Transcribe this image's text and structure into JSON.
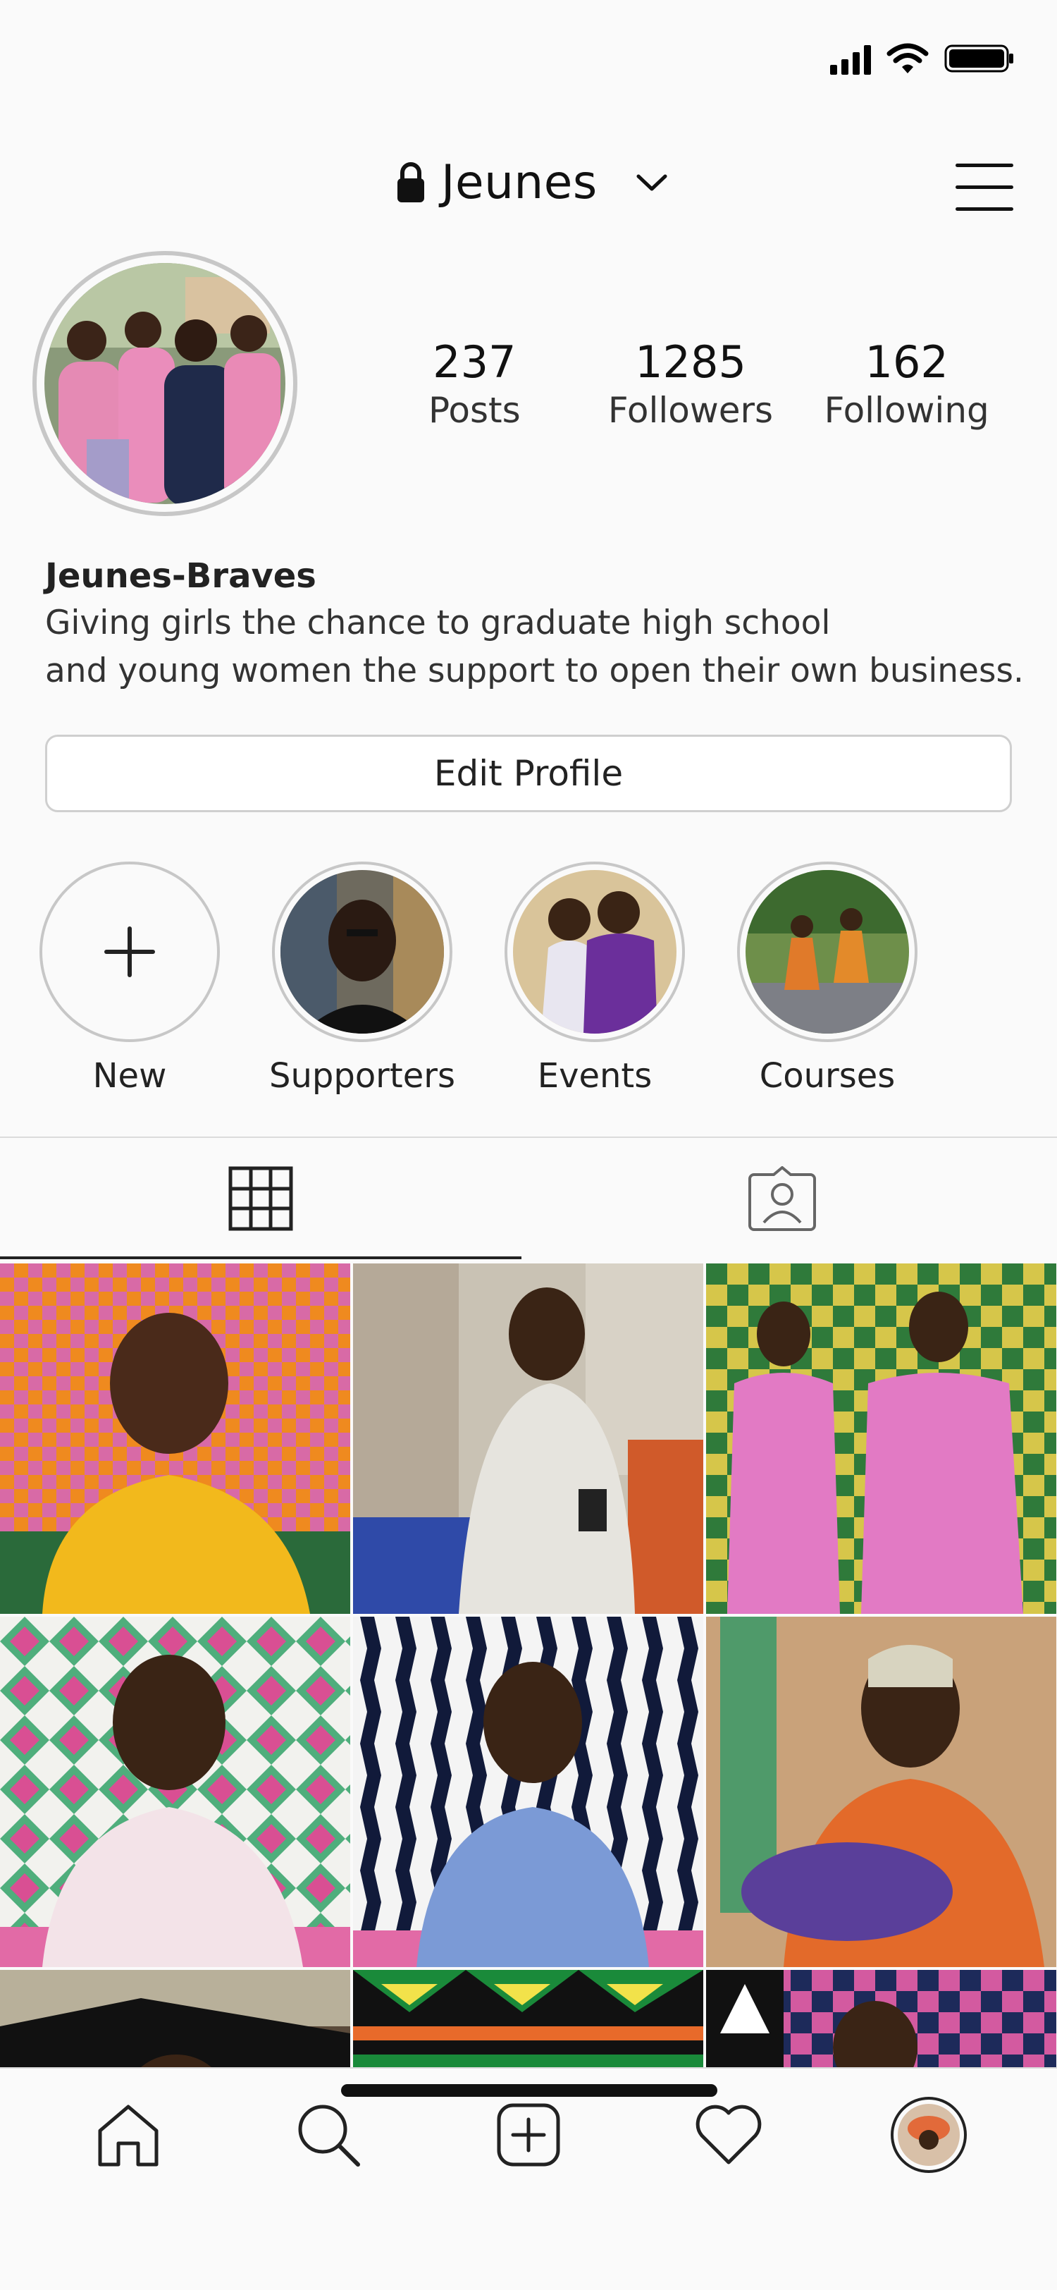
{
  "header": {
    "username": "Jeunes"
  },
  "stats": [
    {
      "value": "237",
      "label": "Posts"
    },
    {
      "value": "1285",
      "label": "Followers"
    },
    {
      "value": "162",
      "label": "Following"
    }
  ],
  "bio": {
    "name": "Jeunes-Braves",
    "line1": "Giving girls the chance to graduate high school",
    "line2": "and young women the support to open their own business."
  },
  "edit_button": "Edit Profile",
  "highlights": [
    "New",
    "Supporters",
    "Events",
    "Courses"
  ],
  "icons": {
    "lock": "lock-icon",
    "chevron": "chevron-down-icon",
    "menu": "hamburger-menu-icon",
    "grid_tab": "grid-icon",
    "tagged_tab": "tagged-person-icon",
    "nav": [
      "home-icon",
      "search-icon",
      "add-post-icon",
      "heart-icon",
      "profile-avatar"
    ]
  },
  "colors": {
    "accent_pink": "#d94fa3",
    "accent_orange": "#ef8a1f",
    "text": "#262626",
    "divider": "#dbdbdb"
  }
}
